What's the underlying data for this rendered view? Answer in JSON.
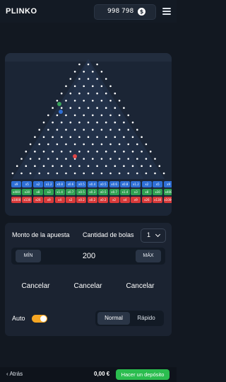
{
  "header": {
    "logo": "PLINKO",
    "balance": "998 798",
    "coin_symbol": "$"
  },
  "board": {
    "ball_colors": [
      "#3ba55c",
      "#2f6fd6",
      "#e04848"
    ],
    "multiplier_rows": [
      {
        "color": "#2f6fd6",
        "values": [
          "x9",
          "x5",
          "x2",
          "x1.2",
          "x0.8",
          "x0.6",
          "x0.5",
          "x0.4",
          "x0.5",
          "x0.6",
          "x0.8",
          "x1.2",
          "x2",
          "x5",
          "x9"
        ]
      },
      {
        "color": "#2fa052",
        "values": [
          "x400",
          "x30",
          "x8",
          "x3",
          "x1.4",
          "x0.7",
          "x0.5",
          "x0.3",
          "x0.5",
          "x0.7",
          "x1.4",
          "x3",
          "x8",
          "x30",
          "x400"
        ]
      },
      {
        "color": "#d83a3a",
        "values": [
          "x1000",
          "x130",
          "x26",
          "x9",
          "x4",
          "x2",
          "x0.2",
          "x0.2",
          "x0.2",
          "x2",
          "x4",
          "x9",
          "x26",
          "x130",
          "x1000"
        ]
      }
    ]
  },
  "panel": {
    "bet_label": "Monto de la apuesta",
    "balls_label": "Cantidad de bolas",
    "balls_value": "1",
    "min_label": "MÍN",
    "max_label": "MÁX",
    "amount": "200",
    "buttons": [
      {
        "label": "Cancelar",
        "color": "#3b7be0"
      },
      {
        "label": "Cancelar",
        "color": "#2ea84a"
      },
      {
        "label": "Cancelar",
        "color": "#e0413f"
      }
    ],
    "auto_label": "Auto",
    "auto_on": true,
    "speed_options": [
      "Normal",
      "Rápido"
    ],
    "speed_selected": "Normal"
  },
  "footer": {
    "back_label": "Atrás",
    "wallet": "0,00 €",
    "deposit_label": "Hacer un depósito"
  }
}
